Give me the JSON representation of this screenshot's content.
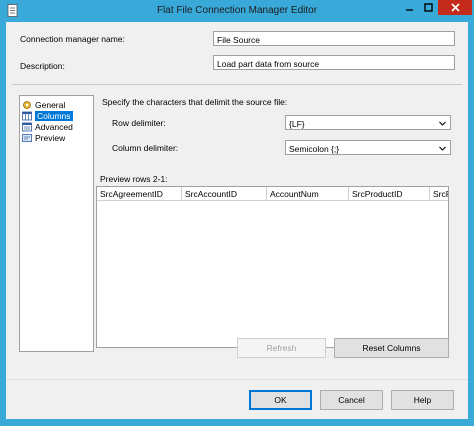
{
  "window": {
    "title": "Flat File Connection Manager Editor",
    "colors": {
      "titlebar": "#39a9d9",
      "close": "#c42b1c",
      "accent": "#0078d7"
    }
  },
  "form": {
    "name_label": "Connection manager name:",
    "name_value": "File Source",
    "description_label": "Description:",
    "description_value": "Load part data from source"
  },
  "nav": {
    "items": [
      {
        "label": "General",
        "icon": "general-icon"
      },
      {
        "label": "Columns",
        "icon": "columns-icon",
        "selected": true
      },
      {
        "label": "Advanced",
        "icon": "advanced-icon"
      },
      {
        "label": "Preview",
        "icon": "preview-icon"
      }
    ]
  },
  "columns": {
    "heading": "Specify the characters that delimit the source file:",
    "row_delimiter_label": "Row delimiter:",
    "row_delimiter_value": "{LF}",
    "column_delimiter_label": "Column delimiter:",
    "column_delimiter_value": "Semicolon {;}",
    "preview_label": "Preview rows 2-1:",
    "grid_headers": [
      "SrcAgreementID",
      "SrcAccountID",
      "AccountNum",
      "SrcProductID",
      "SrcPro"
    ]
  },
  "buttons": {
    "refresh": "Refresh",
    "reset_columns": "Reset Columns",
    "ok": "OK",
    "cancel": "Cancel",
    "help": "Help"
  }
}
